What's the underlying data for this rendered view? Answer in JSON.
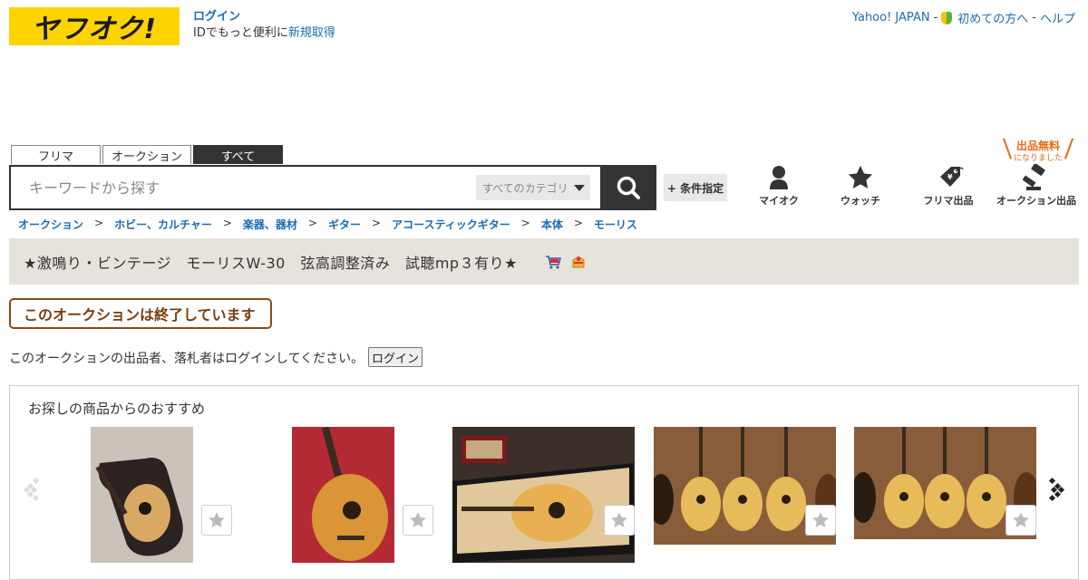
{
  "header": {
    "logo_text": "ヤフオク!",
    "login_label": "ログイン",
    "id_text": "IDでもっと便利に",
    "signup_label": "新規取得",
    "links": [
      "Yahoo! JAPAN",
      "初めての方へ",
      "ヘルプ"
    ],
    "separator": "-"
  },
  "search": {
    "tabs": [
      "フリマ",
      "オークション",
      "すべて"
    ],
    "active_tab": "すべて",
    "placeholder": "キーワードから探す",
    "value": "",
    "category_label": "すべてのカテゴリ",
    "condition_label": "+ 条件指定"
  },
  "nav": {
    "myauc": "マイオク",
    "watch": "ウォッチ",
    "flea_sell": "フリマ出品",
    "auction_sell": "オークション出品",
    "free_badge_main": "出品無料",
    "free_badge_sub": "になりました"
  },
  "breadcrumb": {
    "items": [
      "オークション",
      "ホビー、カルチャー",
      "楽器、器材",
      "ギター",
      "アコースティックギター",
      "本体",
      "モーリス"
    ],
    "separator": ">"
  },
  "item": {
    "title": "★激鳴り・ビンテージ　モーリスW-30　弦高調整済み　試聴mp３有り★"
  },
  "status": {
    "ended_label": "このオークションは終了しています",
    "notice_text": "このオークションの出品者、落札者はログインしてください。",
    "login_button": "ログイン"
  },
  "recommend": {
    "title": "お探しの商品からのおすすめ",
    "items": [
      {
        "image": "guitar-in-case-photo"
      },
      {
        "image": "guitar-on-red-carpet-photo"
      },
      {
        "image": "guitar-in-hardcase-photo"
      },
      {
        "image": "guitar-shop-wall-photo"
      },
      {
        "image": "guitar-shop-wall-photo-2"
      }
    ]
  },
  "colors": {
    "brand_yellow": "#ffd300",
    "link_blue": "#1a6cb5",
    "ended_brown": "#8a4a14",
    "title_bg": "#e5e3dc",
    "free_orange": "#e86b17"
  }
}
